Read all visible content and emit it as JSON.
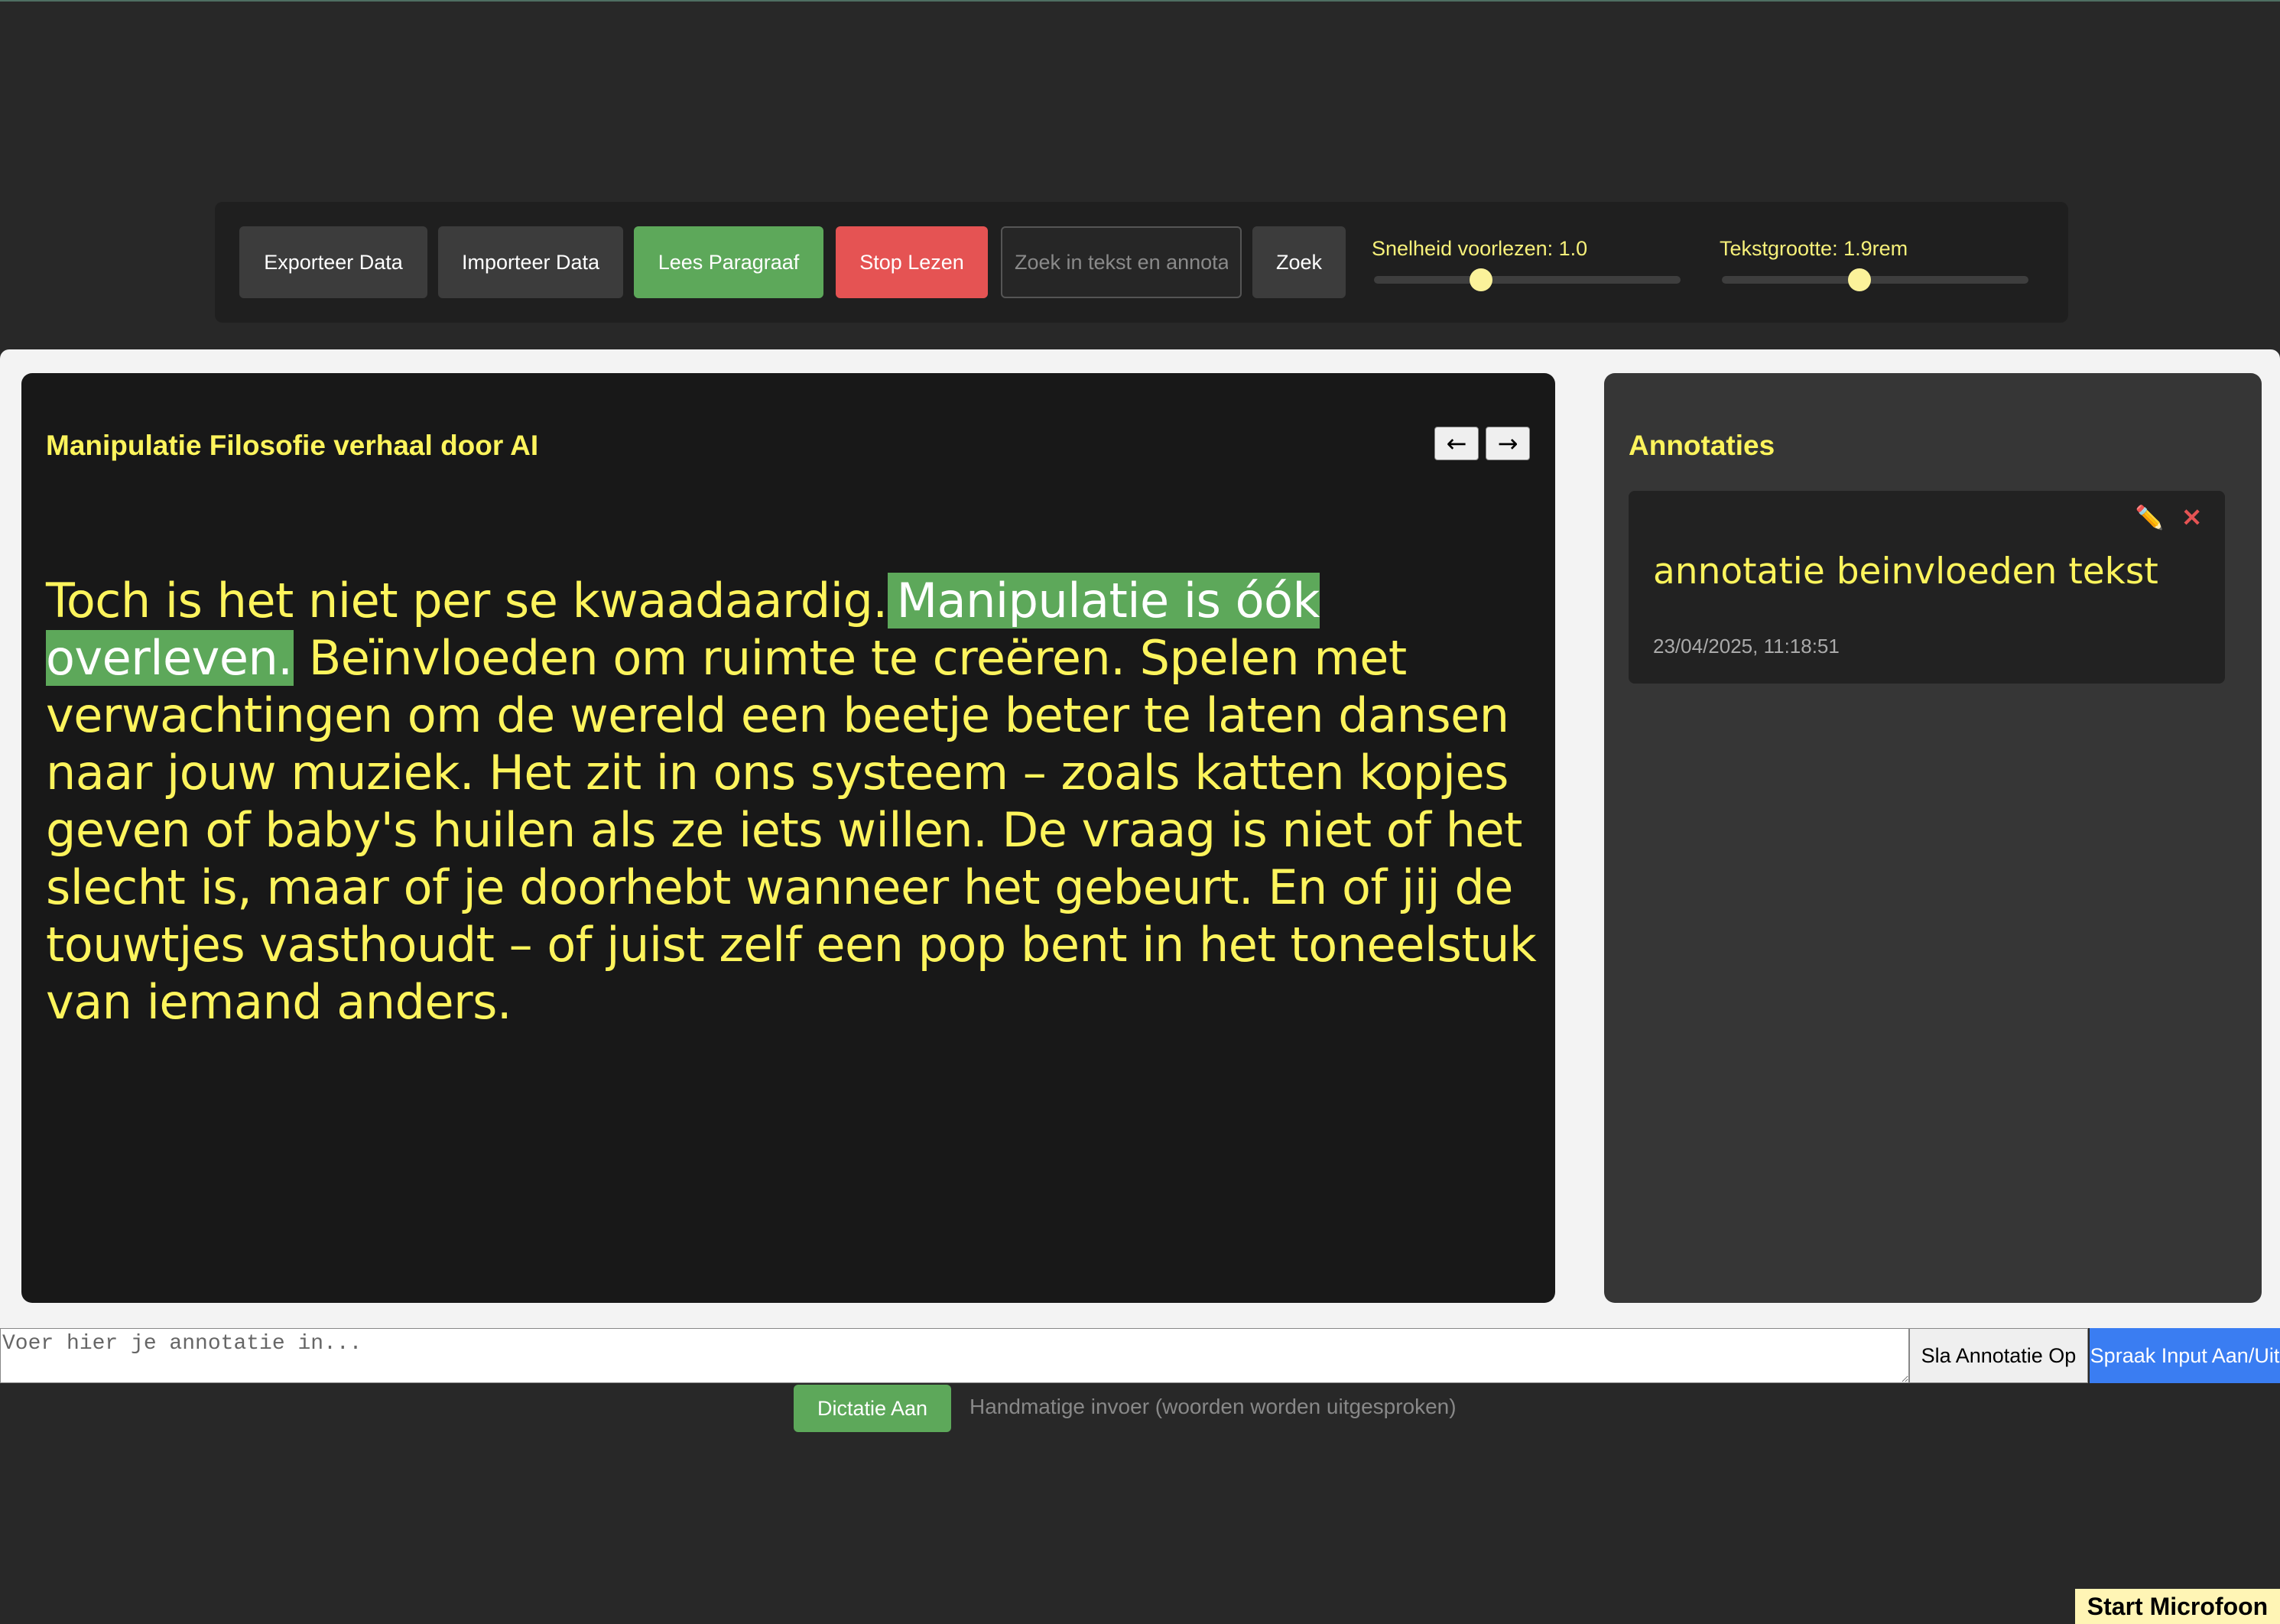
{
  "toolbar": {
    "export_label": "Exporteer Data",
    "import_label": "Importeer Data",
    "read_label": "Lees Paragraaf",
    "stop_label": "Stop Lezen",
    "search_placeholder": "Zoek in tekst en annotaties",
    "search_button": "Zoek",
    "speed_label": "Snelheid voorlezen: 1.0",
    "speed_value": 1.0,
    "textsize_label": "Tekstgrootte: 1.9rem",
    "textsize_value": 1.9
  },
  "reader": {
    "title": "Manipulatie Filosofie verhaal door AI",
    "prev_icon": "←",
    "next_icon": "→",
    "paragraph_before": "Toch is het niet per se kwaadaardig.",
    "paragraph_highlight": "Manipulatie is óók overleven.",
    "paragraph_after": "Beïnvloeden om ruimte te creëren. Spelen met verwachtingen om de wereld een beetje beter te laten dansen naar jouw muziek. Het zit in ons systeem – zoals katten kopjes geven of baby's huilen als ze iets willen. De vraag is niet of het slecht is, maar of je doorhebt wanneer het gebeurt. En of jij de touwtjes vasthoudt – of juist zelf een pop bent in het toneelstuk van iemand anders.",
    "highlight_color": "#5da85a",
    "text_color": "#fdf45c"
  },
  "annotations": {
    "title": "Annotaties",
    "items": [
      {
        "text": "annotatie beinvloeden tekst",
        "date": "23/04/2025, 11:18:51",
        "edit_icon": "✏️",
        "delete_icon": "✕"
      }
    ]
  },
  "input": {
    "placeholder": "Voer hier je annotatie in...",
    "save_label": "Sla Annotatie Op",
    "voice_label": "Spraak Input Aan/Uit"
  },
  "dictation": {
    "button_label": "Dictatie Aan",
    "hint": "Handmatige invoer (woorden worden uitgesproken)"
  },
  "mic": {
    "label": "Start Microfoon"
  }
}
